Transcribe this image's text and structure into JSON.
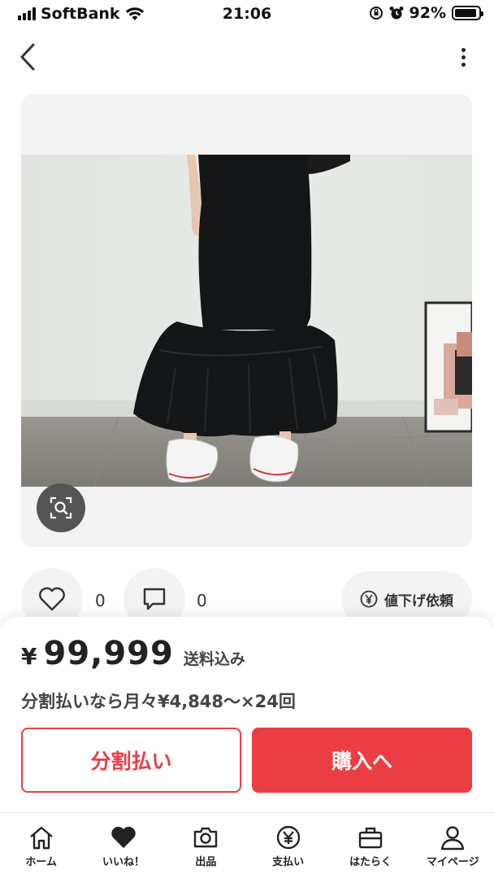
{
  "status_bar": {
    "carrier": "SoftBank",
    "time": "21:06",
    "battery": "92%",
    "battery_level": 0.92
  },
  "icons": {
    "back": "chevron-left-icon",
    "more": "more-vertical-icon",
    "image_search": "image-search-icon",
    "like": "heart-outline-icon",
    "comment": "comment-icon",
    "yen": "yen-circle-icon"
  },
  "product": {
    "like_count": "0",
    "comment_count": "0",
    "discount_request_label": "値下げ依頼"
  },
  "purchase": {
    "currency": "¥",
    "price": "99,999",
    "shipping_note": "送料込み",
    "installment_text": "分割払いなら月々¥4,848〜×24回",
    "split_pay_label": "分割払い",
    "buy_label": "購入へ"
  },
  "tabbar": {
    "items": [
      {
        "label": "ホーム",
        "icon": "home-icon"
      },
      {
        "label": "いいね！",
        "icon": "heart-filled-icon"
      },
      {
        "label": "出品",
        "icon": "camera-icon"
      },
      {
        "label": "支払い",
        "icon": "yen-icon"
      },
      {
        "label": "はたらく",
        "icon": "briefcase-icon"
      },
      {
        "label": "マイページ",
        "icon": "person-icon"
      }
    ]
  },
  "colors": {
    "accent": "#ea3e44",
    "card_bg": "#f3f3f3",
    "dress": "#141517",
    "wall": "#e3e7e3",
    "floor": "#8f8c87"
  }
}
